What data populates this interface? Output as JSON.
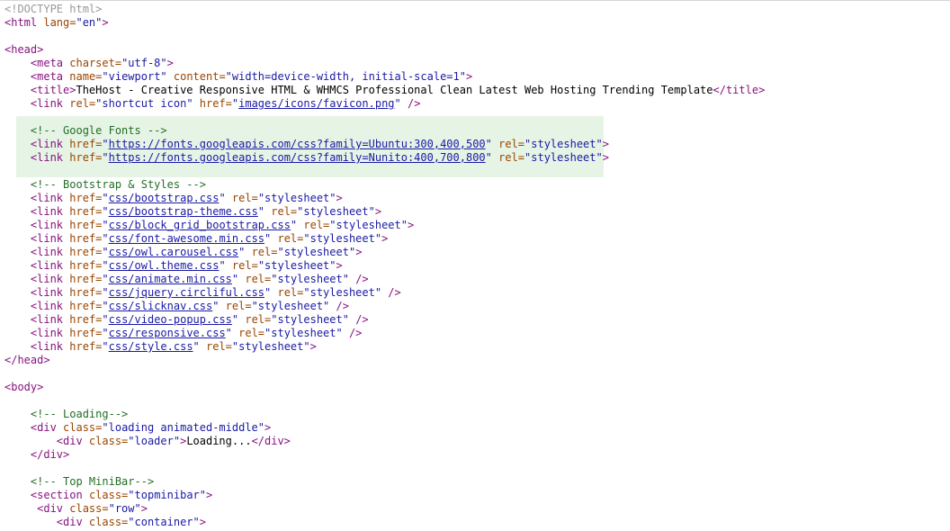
{
  "source": {
    "lines": [
      [
        [
          "doc",
          "<!DOCTYPE html>"
        ]
      ],
      [
        [
          "tag",
          "<html "
        ],
        [
          "attr",
          "lang="
        ],
        [
          "val",
          "\"en\""
        ],
        [
          "tag",
          ">"
        ]
      ],
      [],
      [
        [
          "tag",
          "<head>"
        ]
      ],
      [
        [
          "txt",
          "    "
        ],
        [
          "tag",
          "<meta "
        ],
        [
          "attr",
          "charset="
        ],
        [
          "val",
          "\"utf-8\""
        ],
        [
          "tag",
          ">"
        ]
      ],
      [
        [
          "txt",
          "    "
        ],
        [
          "tag",
          "<meta "
        ],
        [
          "attr",
          "name="
        ],
        [
          "val",
          "\"viewport\" "
        ],
        [
          "attr",
          "content="
        ],
        [
          "val",
          "\"width=device-width, initial-scale=1\""
        ],
        [
          "tag",
          ">"
        ]
      ],
      [
        [
          "txt",
          "    "
        ],
        [
          "tag",
          "<title>"
        ],
        [
          "txt",
          "TheHost - Creative Responsive HTML & WHMCS Professional Clean Latest Web Hosting Trending Template"
        ],
        [
          "tag",
          "</title>"
        ]
      ],
      [
        [
          "txt",
          "    "
        ],
        [
          "tag",
          "<link "
        ],
        [
          "attr",
          "rel="
        ],
        [
          "val",
          "\"shortcut icon\" "
        ],
        [
          "attr",
          "href="
        ],
        [
          "val",
          "\""
        ],
        [
          "link",
          "images/icons/favicon.png"
        ],
        [
          "val",
          "\" "
        ],
        [
          "tag",
          "/>"
        ]
      ],
      [],
      [
        [
          "txt",
          "    "
        ],
        [
          "cmt",
          "<!-- Google Fonts -->"
        ]
      ],
      [
        [
          "txt",
          "    "
        ],
        [
          "tag",
          "<link "
        ],
        [
          "attr",
          "href="
        ],
        [
          "val",
          "\""
        ],
        [
          "link",
          "https://fonts.googleapis.com/css?family=Ubuntu:300,400,500"
        ],
        [
          "val",
          "\" "
        ],
        [
          "attr",
          "rel="
        ],
        [
          "val",
          "\"stylesheet\""
        ],
        [
          "tag",
          ">"
        ]
      ],
      [
        [
          "txt",
          "    "
        ],
        [
          "tag",
          "<link "
        ],
        [
          "attr",
          "href="
        ],
        [
          "val",
          "\""
        ],
        [
          "link",
          "https://fonts.googleapis.com/css?family=Nunito:400,700,800"
        ],
        [
          "val",
          "\" "
        ],
        [
          "attr",
          "rel="
        ],
        [
          "val",
          "\"stylesheet\""
        ],
        [
          "tag",
          ">"
        ]
      ],
      [],
      [
        [
          "txt",
          "    "
        ],
        [
          "cmt",
          "<!-- Bootstrap & Styles -->"
        ]
      ],
      [
        [
          "txt",
          "    "
        ],
        [
          "tag",
          "<link "
        ],
        [
          "attr",
          "href="
        ],
        [
          "val",
          "\""
        ],
        [
          "link",
          "css/bootstrap.css"
        ],
        [
          "val",
          "\" "
        ],
        [
          "attr",
          "rel="
        ],
        [
          "val",
          "\"stylesheet\""
        ],
        [
          "tag",
          ">"
        ]
      ],
      [
        [
          "txt",
          "    "
        ],
        [
          "tag",
          "<link "
        ],
        [
          "attr",
          "href="
        ],
        [
          "val",
          "\""
        ],
        [
          "link",
          "css/bootstrap-theme.css"
        ],
        [
          "val",
          "\" "
        ],
        [
          "attr",
          "rel="
        ],
        [
          "val",
          "\"stylesheet\""
        ],
        [
          "tag",
          ">"
        ]
      ],
      [
        [
          "txt",
          "    "
        ],
        [
          "tag",
          "<link "
        ],
        [
          "attr",
          "href="
        ],
        [
          "val",
          "\""
        ],
        [
          "link",
          "css/block_grid_bootstrap.css"
        ],
        [
          "val",
          "\" "
        ],
        [
          "attr",
          "rel="
        ],
        [
          "val",
          "\"stylesheet\""
        ],
        [
          "tag",
          ">"
        ]
      ],
      [
        [
          "txt",
          "    "
        ],
        [
          "tag",
          "<link "
        ],
        [
          "attr",
          "href="
        ],
        [
          "val",
          "\""
        ],
        [
          "link",
          "css/font-awesome.min.css"
        ],
        [
          "val",
          "\" "
        ],
        [
          "attr",
          "rel="
        ],
        [
          "val",
          "\"stylesheet\""
        ],
        [
          "tag",
          ">"
        ]
      ],
      [
        [
          "txt",
          "    "
        ],
        [
          "tag",
          "<link "
        ],
        [
          "attr",
          "href="
        ],
        [
          "val",
          "\""
        ],
        [
          "link",
          "css/owl.carousel.css"
        ],
        [
          "val",
          "\" "
        ],
        [
          "attr",
          "rel="
        ],
        [
          "val",
          "\"stylesheet\""
        ],
        [
          "tag",
          ">"
        ]
      ],
      [
        [
          "txt",
          "    "
        ],
        [
          "tag",
          "<link "
        ],
        [
          "attr",
          "href="
        ],
        [
          "val",
          "\""
        ],
        [
          "link",
          "css/owl.theme.css"
        ],
        [
          "val",
          "\" "
        ],
        [
          "attr",
          "rel="
        ],
        [
          "val",
          "\"stylesheet\""
        ],
        [
          "tag",
          ">"
        ]
      ],
      [
        [
          "txt",
          "    "
        ],
        [
          "tag",
          "<link "
        ],
        [
          "attr",
          "href="
        ],
        [
          "val",
          "\""
        ],
        [
          "link",
          "css/animate.min.css"
        ],
        [
          "val",
          "\" "
        ],
        [
          "attr",
          "rel="
        ],
        [
          "val",
          "\"stylesheet\" "
        ],
        [
          "tag",
          "/>"
        ]
      ],
      [
        [
          "txt",
          "    "
        ],
        [
          "tag",
          "<link "
        ],
        [
          "attr",
          "href="
        ],
        [
          "val",
          "\""
        ],
        [
          "link",
          "css/jquery.circliful.css"
        ],
        [
          "val",
          "\" "
        ],
        [
          "attr",
          "rel="
        ],
        [
          "val",
          "\"stylesheet\" "
        ],
        [
          "tag",
          "/>"
        ]
      ],
      [
        [
          "txt",
          "    "
        ],
        [
          "tag",
          "<link "
        ],
        [
          "attr",
          "href="
        ],
        [
          "val",
          "\""
        ],
        [
          "link",
          "css/slicknav.css"
        ],
        [
          "val",
          "\" "
        ],
        [
          "attr",
          "rel="
        ],
        [
          "val",
          "\"stylesheet\" "
        ],
        [
          "tag",
          "/>"
        ]
      ],
      [
        [
          "txt",
          "    "
        ],
        [
          "tag",
          "<link "
        ],
        [
          "attr",
          "href="
        ],
        [
          "val",
          "\""
        ],
        [
          "link",
          "css/video-popup.css"
        ],
        [
          "val",
          "\" "
        ],
        [
          "attr",
          "rel="
        ],
        [
          "val",
          "\"stylesheet\" "
        ],
        [
          "tag",
          "/>"
        ]
      ],
      [
        [
          "txt",
          "    "
        ],
        [
          "tag",
          "<link "
        ],
        [
          "attr",
          "href="
        ],
        [
          "val",
          "\""
        ],
        [
          "link",
          "css/responsive.css"
        ],
        [
          "val",
          "\" "
        ],
        [
          "attr",
          "rel="
        ],
        [
          "val",
          "\"stylesheet\" "
        ],
        [
          "tag",
          "/>"
        ]
      ],
      [
        [
          "txt",
          "    "
        ],
        [
          "tag",
          "<link "
        ],
        [
          "attr",
          "href="
        ],
        [
          "val",
          "\""
        ],
        [
          "link",
          "css/style.css"
        ],
        [
          "val",
          "\" "
        ],
        [
          "attr",
          "rel="
        ],
        [
          "val",
          "\"stylesheet\""
        ],
        [
          "tag",
          ">"
        ]
      ],
      [
        [
          "tag",
          "</head>"
        ]
      ],
      [],
      [
        [
          "tag",
          "<body>"
        ]
      ],
      [],
      [
        [
          "txt",
          "    "
        ],
        [
          "cmt",
          "<!-- Loading-->"
        ]
      ],
      [
        [
          "txt",
          "    "
        ],
        [
          "tag",
          "<div "
        ],
        [
          "attr",
          "class="
        ],
        [
          "val",
          "\"loading animated-middle\""
        ],
        [
          "tag",
          ">"
        ]
      ],
      [
        [
          "txt",
          "        "
        ],
        [
          "tag",
          "<div "
        ],
        [
          "attr",
          "class="
        ],
        [
          "val",
          "\"loader\""
        ],
        [
          "tag",
          ">"
        ],
        [
          "txt",
          "Loading..."
        ],
        [
          "tag",
          "</div>"
        ]
      ],
      [
        [
          "txt",
          "    "
        ],
        [
          "tag",
          "</div>"
        ]
      ],
      [],
      [
        [
          "txt",
          "    "
        ],
        [
          "cmt",
          "<!-- Top MiniBar-->"
        ]
      ],
      [
        [
          "txt",
          "    "
        ],
        [
          "tag",
          "<section "
        ],
        [
          "attr",
          "class="
        ],
        [
          "val",
          "\"topminibar\""
        ],
        [
          "tag",
          ">"
        ]
      ],
      [
        [
          "txt",
          "     "
        ],
        [
          "tag",
          "<div "
        ],
        [
          "attr",
          "class="
        ],
        [
          "val",
          "\"row\""
        ],
        [
          "tag",
          ">"
        ]
      ],
      [
        [
          "txt",
          "        "
        ],
        [
          "tag",
          "<div "
        ],
        [
          "attr",
          "class="
        ],
        [
          "val",
          "\"container\""
        ],
        [
          "tag",
          ">"
        ]
      ]
    ]
  }
}
